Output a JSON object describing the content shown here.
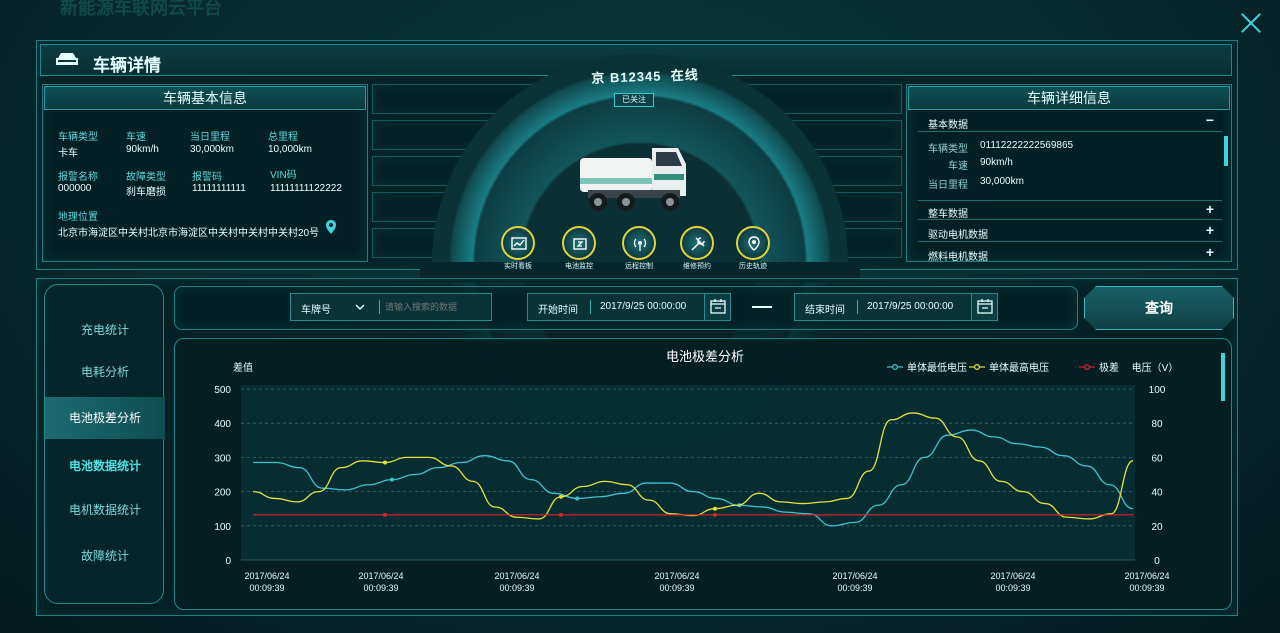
{
  "background_title": "新能源车联网云平台",
  "header": {
    "title": "车辆详情"
  },
  "basic_info": {
    "title": "车辆基本信息",
    "fields": [
      {
        "label": "车辆类型",
        "value": "卡车"
      },
      {
        "label": "车速",
        "value": "90km/h"
      },
      {
        "label": "当日里程",
        "value": "30,000km"
      },
      {
        "label": "总里程",
        "value": "10,000km"
      },
      {
        "label": "报警名称",
        "value": "000000"
      },
      {
        "label": "故障类型",
        "value": "刹车磨损"
      },
      {
        "label": "报警码",
        "value": "11111111111"
      },
      {
        "label": "VIN码",
        "value": "11111111122222"
      }
    ],
    "location_label": "地理位置",
    "location_value": "北京市海淀区中关村北京市海淀区中关村中关村中关村20号"
  },
  "vehicle": {
    "plate": "京 B12345",
    "status": "在线",
    "follow_label": "已关注",
    "actions": [
      {
        "icon": "dashboard-icon",
        "label": "实时看板"
      },
      {
        "icon": "battery-icon",
        "label": "电池监控"
      },
      {
        "icon": "remote-signal-icon",
        "label": "远程控制"
      },
      {
        "icon": "wrench-icon",
        "label": "维修预约"
      },
      {
        "icon": "location-pin-icon",
        "label": "历史轨迹"
      }
    ]
  },
  "detail_info": {
    "title": "车辆详细信息",
    "sections": [
      {
        "title": "基本数据",
        "toggle": "−",
        "expanded": true,
        "rows": [
          {
            "label": "车辆类型",
            "value": "01112222222569865"
          },
          {
            "label": "车速",
            "value": "90km/h"
          },
          {
            "label": "当日里程",
            "value": "30,000km"
          }
        ]
      },
      {
        "title": "整车数据",
        "toggle": "+"
      },
      {
        "title": "驱动电机数据",
        "toggle": "+"
      },
      {
        "title": "燃料电机数据",
        "toggle": "+"
      }
    ]
  },
  "sidebar": {
    "items": [
      {
        "label": "充电统计",
        "active": false
      },
      {
        "label": "电耗分析",
        "active": false
      },
      {
        "label": "电池极差分析",
        "active": true
      },
      {
        "label": "电池数据统计",
        "active": false
      },
      {
        "label": "电机数据统计",
        "active": false
      },
      {
        "label": "故障统计",
        "active": false
      }
    ]
  },
  "filters": {
    "plate_select": "车牌号",
    "search_placeholder": "请输入搜索的数据",
    "start_label": "开始时间",
    "start_value": "2017/9/25  00:00:00",
    "end_label": "结束时间",
    "end_value": "2017/9/25  00:00:00",
    "query_button": "查询"
  },
  "colors": {
    "min_voltage": "#3fc3cf",
    "max_voltage": "#e3e23a",
    "range": "#d8262a",
    "accent": "#35b9c1"
  },
  "chart_data": {
    "type": "line",
    "title": "电池极差分析",
    "ylabel_left": "差值",
    "ylabel_right": "电压（V）",
    "left_ticks": [
      0,
      100,
      200,
      300,
      400,
      500
    ],
    "right_ticks": [
      0,
      20,
      40,
      60,
      80,
      100
    ],
    "ylim_left": [
      0,
      500
    ],
    "ylim_right": [
      0,
      100
    ],
    "x_tick_labels": [
      "2017/06/24\n00:09:39",
      "2017/06/24\n00:09:39",
      "2017/06/24\n00:09:39",
      "2017/06/24\n00:09:39",
      "2017/06/24\n00:09:39",
      "2017/06/24\n00:09:39",
      "2017/06/24\n00:09:39"
    ],
    "legend_position": "top-right",
    "grid": true,
    "series": [
      {
        "name": "单体最低电压",
        "axis": "right",
        "color": "#3fc3cf",
        "values": [
          57,
          57,
          54,
          42,
          41,
          44,
          47,
          50,
          54,
          57,
          61,
          58,
          47,
          39,
          36,
          37,
          39,
          45,
          45,
          40,
          36,
          32,
          31,
          28,
          27,
          20,
          22,
          32,
          44,
          60,
          73,
          76,
          72,
          68,
          66,
          61,
          55,
          44,
          30
        ]
      },
      {
        "name": "单体最高电压",
        "axis": "right",
        "color": "#e3e23a",
        "values": [
          40,
          36,
          34,
          40,
          54,
          58,
          57,
          60,
          60,
          55,
          46,
          31,
          25,
          24,
          37,
          43,
          46,
          44,
          35,
          27,
          26,
          30,
          32,
          39,
          34,
          33,
          34,
          36,
          52,
          82,
          86,
          83,
          72,
          58,
          46,
          40,
          33,
          25,
          24,
          27,
          58
        ]
      },
      {
        "name": "极差",
        "axis": "left",
        "color": "#d8262a",
        "values": [
          132,
          132,
          132,
          132,
          132,
          132,
          132,
          132,
          132,
          132,
          132,
          132,
          132,
          132,
          132,
          132,
          132,
          132,
          132,
          132,
          132,
          132,
          132,
          132,
          132,
          132,
          132,
          132,
          132,
          132,
          132,
          132,
          132,
          132,
          132,
          132,
          132,
          132,
          132,
          132,
          132
        ]
      }
    ]
  }
}
